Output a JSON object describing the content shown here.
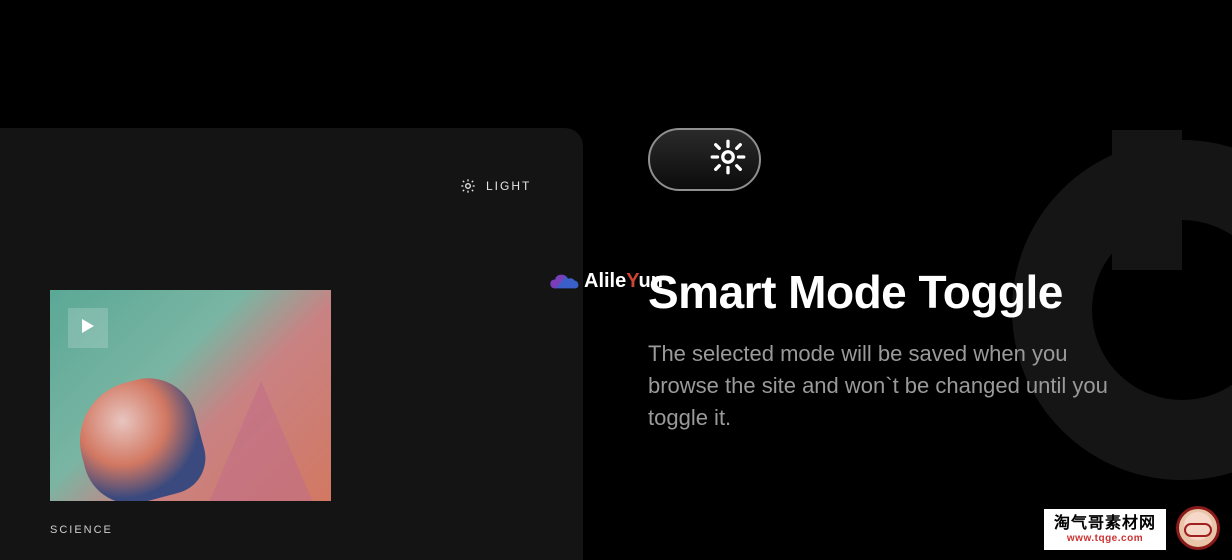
{
  "left": {
    "mode_label": "LIGHT",
    "category": "SCIENCE"
  },
  "feature": {
    "heading": "Smart Mode Toggle",
    "description": "The selected mode will be saved when you browse the site and won`t be changed until you toggle it."
  },
  "watermark_center": {
    "prefix": "Alile",
    "accent": "Y",
    "suffix": "un"
  },
  "badge": {
    "line1": "淘气哥素材网",
    "line2": "www.tqge.com"
  },
  "icons": {
    "sun": "sun-icon",
    "play": "play-icon",
    "cloud": "cloud-icon",
    "glasses": "glasses-icon"
  }
}
